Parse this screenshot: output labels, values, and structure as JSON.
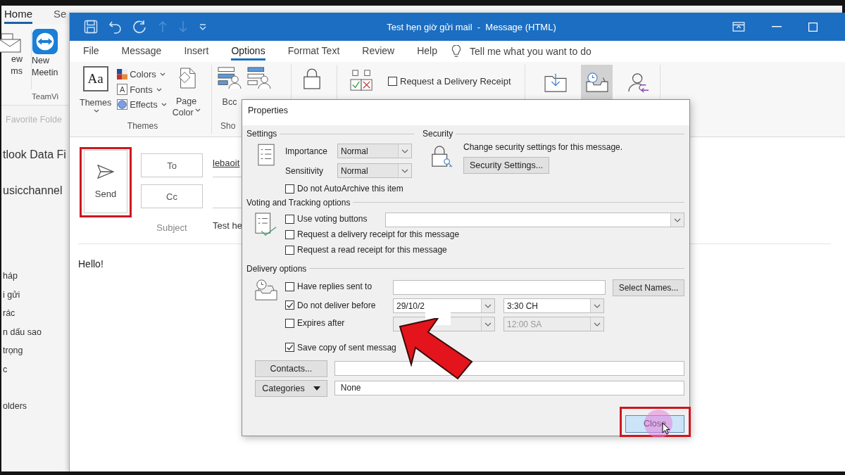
{
  "outlook": {
    "tabs": [
      {
        "label": "Home",
        "selected": true
      },
      {
        "label": "Se",
        "selected": false
      }
    ],
    "new_items": [
      "ew",
      "ms"
    ],
    "meeting": [
      "New",
      "Meetin"
    ],
    "group_label": "TeamVi",
    "favorites": "Favorite Folde",
    "folders": [
      {
        "kind": "account",
        "label": "tlook Data Fi"
      },
      {
        "kind": "account",
        "label": "usicchannel"
      },
      {
        "kind": "folder",
        "label": "háp"
      },
      {
        "kind": "folder",
        "label": "i gửi"
      },
      {
        "kind": "folder",
        "label": "rác"
      },
      {
        "kind": "folder",
        "label": "n dấu sao"
      },
      {
        "kind": "folder",
        "label": "trọng"
      },
      {
        "kind": "folder",
        "label": "c"
      },
      {
        "kind": "heading",
        "label": "olders"
      }
    ]
  },
  "message": {
    "title": "Test hẹn giờ gửi mail  -  Message (HTML)",
    "tabs": [
      {
        "label": "File",
        "selected": false
      },
      {
        "label": "Message",
        "selected": false
      },
      {
        "label": "Insert",
        "selected": false
      },
      {
        "label": "Options",
        "selected": true
      },
      {
        "label": "Format Text",
        "selected": false
      },
      {
        "label": "Review",
        "selected": false
      },
      {
        "label": "Help",
        "selected": false
      }
    ],
    "tell_me": "Tell me what you want to do",
    "themes_group": {
      "themes": "Themes",
      "themes_icon_text": "Aa",
      "colors": "Colors",
      "fonts": "Fonts",
      "fonts_icon_text": "A",
      "effects": "Effects",
      "page_color": [
        "Page",
        "Color"
      ],
      "label": "Themes"
    },
    "show_fields_group": {
      "bcc": "Bcc",
      "label": "Sho"
    },
    "delivery_receipt": {
      "label": "Request a Delivery Receipt",
      "checked": false
    },
    "more_options": [
      {
        "kind": "save_to",
        "on": false
      },
      {
        "kind": "delay",
        "on": true
      },
      {
        "kind": "replies",
        "on": false
      }
    ],
    "compose": {
      "send": "Send",
      "to": "To",
      "cc": "Cc",
      "to_value": "lebaoit",
      "subject_label": "Subject",
      "subject_value": "Test he",
      "body": "Hello!"
    }
  },
  "properties": {
    "title": "Properties",
    "settings": {
      "heading": "Settings",
      "fields": [
        {
          "label": "Importance",
          "value": "Normal"
        },
        {
          "label": "Sensitivity",
          "value": "Normal"
        }
      ],
      "autoarchive": {
        "label": "Do not AutoArchive this item",
        "checked": false
      }
    },
    "security": {
      "heading": "Security",
      "text": "Change security settings for this message.",
      "button": "Security Settings..."
    },
    "voting": {
      "heading": "Voting and Tracking options",
      "options": [
        {
          "label": "Use voting buttons",
          "checked": false
        },
        {
          "label": "Request a delivery receipt for this message",
          "checked": false
        },
        {
          "label": "Request a read receipt for this message",
          "checked": false
        }
      ]
    },
    "delivery": {
      "heading": "Delivery options",
      "replies": {
        "label": "Have replies sent to",
        "checked": false,
        "button": "Select Names..."
      },
      "deliver_before": {
        "label": "Do not deliver before",
        "checked": true,
        "date": "29/10/2",
        "time": "3:30 CH"
      },
      "expires": {
        "label": "Expires after",
        "checked": false,
        "time": "12:00 SA"
      },
      "save_copy": {
        "label": "Save copy of sent messag",
        "checked": true
      }
    },
    "contacts": "Contacts...",
    "categories": {
      "button": "Categories",
      "value": "None"
    },
    "close": "Close"
  }
}
